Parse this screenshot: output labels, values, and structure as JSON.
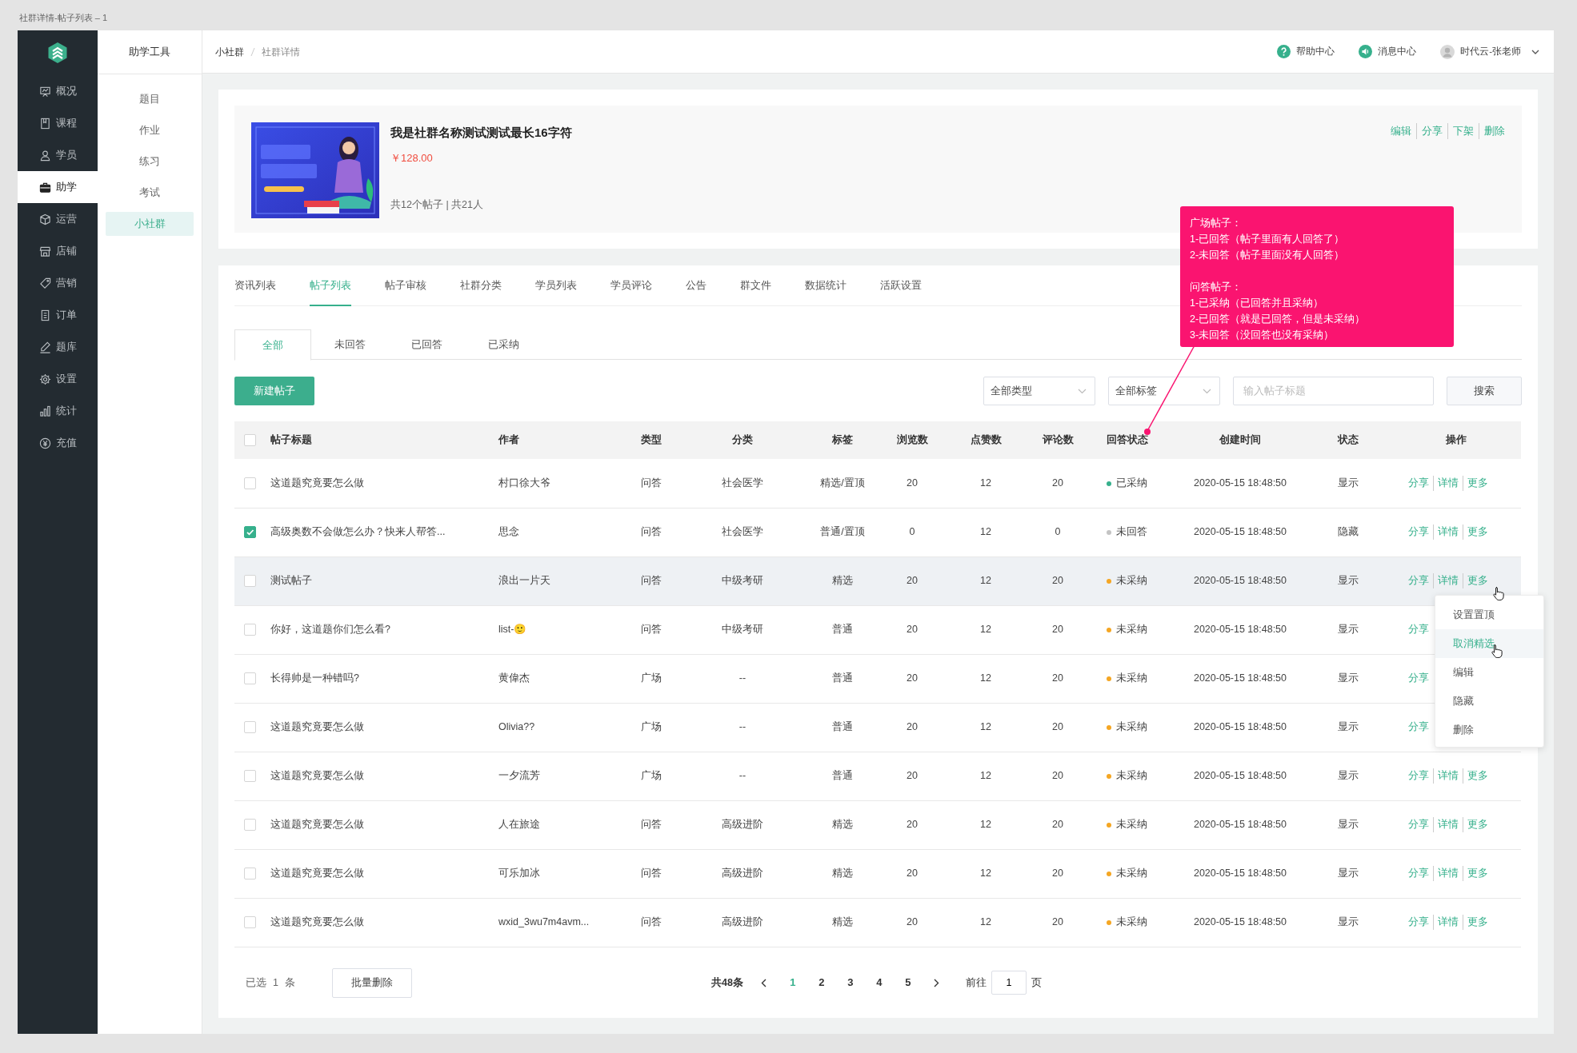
{
  "window": {
    "title": "社群详情-帖子列表 – 1"
  },
  "sidebar": {
    "items": [
      {
        "label": "概况",
        "selected": false
      },
      {
        "label": "课程",
        "selected": false
      },
      {
        "label": "学员",
        "selected": false
      },
      {
        "label": "助学",
        "selected": true
      },
      {
        "label": "运营",
        "selected": false
      },
      {
        "label": "店铺",
        "selected": false
      },
      {
        "label": "营销",
        "selected": false
      },
      {
        "label": "订单",
        "selected": false
      },
      {
        "label": "题库",
        "selected": false
      },
      {
        "label": "设置",
        "selected": false
      },
      {
        "label": "统计",
        "selected": false
      },
      {
        "label": "充值",
        "selected": false
      }
    ]
  },
  "subnav": {
    "title": "助学工具",
    "items": [
      {
        "label": "题目",
        "selected": false
      },
      {
        "label": "作业",
        "selected": false
      },
      {
        "label": "练习",
        "selected": false
      },
      {
        "label": "考试",
        "selected": false
      },
      {
        "label": "小社群",
        "selected": true
      }
    ]
  },
  "header": {
    "breadcrumb": [
      "小社群",
      "社群详情"
    ],
    "help": "帮助中心",
    "messages": "消息中心",
    "user": "时代云-张老师"
  },
  "community": {
    "image": {
      "kind": "picture"
    },
    "name": "我是社群名称测试测试最长16字符",
    "price": "￥128.00",
    "stats": "共12个帖子 | 共21人",
    "actions": [
      "编辑",
      "分享",
      "下架",
      "删除"
    ]
  },
  "tabs": [
    {
      "label": "资讯列表",
      "selected": false
    },
    {
      "label": "帖子列表",
      "selected": true
    },
    {
      "label": "帖子审核",
      "selected": false
    },
    {
      "label": "社群分类",
      "selected": false
    },
    {
      "label": "学员列表",
      "selected": false
    },
    {
      "label": "学员评论",
      "selected": false
    },
    {
      "label": "公告",
      "selected": false
    },
    {
      "label": "群文件",
      "selected": false
    },
    {
      "label": "数据统计",
      "selected": false
    },
    {
      "label": "活跃设置",
      "selected": false
    }
  ],
  "filter_tabs": [
    {
      "label": "全部",
      "selected": true
    },
    {
      "label": "未回答",
      "selected": false
    },
    {
      "label": "已回答",
      "selected": false
    },
    {
      "label": "已采纳",
      "selected": false
    }
  ],
  "toolbar": {
    "new_button": "新建帖子",
    "type_select": "全部类型",
    "tag_select": "全部标签",
    "search": {
      "placeholder": "输入帖子标题"
    },
    "search_button": "搜索"
  },
  "table": {
    "select_all": false,
    "columns": [
      "帖子标题",
      "作者",
      "类型",
      "分类",
      "标签",
      "浏览数",
      "点赞数",
      "评论数",
      "回答状态",
      "创建时间",
      "状态",
      "操作"
    ],
    "rows": [
      {
        "checked": false,
        "highlighted": false,
        "title": "这道题究竟要怎么做",
        "author": "村口徐大爷",
        "type": "问答",
        "category": "社会医学",
        "tag": "精选/置顶",
        "views": "20",
        "likes": "12",
        "comments": "20",
        "answer_status": "已采纳",
        "color": "#36b08c",
        "created": "2020-05-15 18:48:50",
        "state": "显示",
        "actions": [
          "分享",
          "详情",
          "更多"
        ]
      },
      {
        "checked": true,
        "highlighted": false,
        "title": "高级奥数不会做怎么办？快来人帮答...",
        "author": "思念",
        "type": "问答",
        "category": "社会医学",
        "tag": "普通/置顶",
        "views": "0",
        "likes": "12",
        "comments": "0",
        "answer_status": "未回答",
        "color": "#c4c4c4",
        "created": "2020-05-15 18:48:50",
        "state": "隐藏",
        "actions": [
          "分享",
          "详情",
          "更多"
        ]
      },
      {
        "checked": false,
        "highlighted": true,
        "title": "测试帖子",
        "author": "浪出一片天",
        "type": "问答",
        "category": "中级考研",
        "tag": "精选",
        "views": "20",
        "likes": "12",
        "comments": "20",
        "answer_status": "未采纳",
        "color": "#f5a623",
        "created": "2020-05-15 18:48:50",
        "state": "显示",
        "actions": [
          "分享",
          "详情",
          "更多"
        ]
      },
      {
        "checked": false,
        "highlighted": false,
        "title": "你好，这道题你们怎么看?",
        "author": "list-🙂",
        "type": "问答",
        "category": "中级考研",
        "tag": "普通",
        "views": "20",
        "likes": "12",
        "comments": "20",
        "answer_status": "未采纳",
        "color": "#f5a623",
        "created": "2020-05-15 18:48:50",
        "state": "显示",
        "actions": [
          "分享"
        ]
      },
      {
        "checked": false,
        "highlighted": false,
        "title": "长得帅是一种错吗?",
        "author": "黄偉杰",
        "type": "广场",
        "category": "--",
        "tag": "普通",
        "views": "20",
        "likes": "12",
        "comments": "20",
        "answer_status": "未采纳",
        "color": "#f5a623",
        "created": "2020-05-15 18:48:50",
        "state": "显示",
        "actions": [
          "分享"
        ]
      },
      {
        "checked": false,
        "highlighted": false,
        "title": "这道题究竟要怎么做",
        "author": "Olivia??",
        "type": "广场",
        "category": "--",
        "tag": "普通",
        "views": "20",
        "likes": "12",
        "comments": "20",
        "answer_status": "未采纳",
        "color": "#f5a623",
        "created": "2020-05-15 18:48:50",
        "state": "显示",
        "actions": [
          "分享"
        ]
      },
      {
        "checked": false,
        "highlighted": false,
        "title": "这道题究竟要怎么做",
        "author": "一夕流芳",
        "type": "广场",
        "category": "--",
        "tag": "普通",
        "views": "20",
        "likes": "12",
        "comments": "20",
        "answer_status": "未采纳",
        "color": "#f5a623",
        "created": "2020-05-15 18:48:50",
        "state": "显示",
        "actions": [
          "分享",
          "详情",
          "更多"
        ]
      },
      {
        "checked": false,
        "highlighted": false,
        "title": "这道题究竟要怎么做",
        "author": "人在旅途",
        "type": "问答",
        "category": "高级进阶",
        "tag": "精选",
        "views": "20",
        "likes": "12",
        "comments": "20",
        "answer_status": "未采纳",
        "color": "#f5a623",
        "created": "2020-05-15 18:48:50",
        "state": "显示",
        "actions": [
          "分享",
          "详情",
          "更多"
        ]
      },
      {
        "checked": false,
        "highlighted": false,
        "title": "这道题究竟要怎么做",
        "author": "可乐加冰",
        "type": "问答",
        "category": "高级进阶",
        "tag": "精选",
        "views": "20",
        "likes": "12",
        "comments": "20",
        "answer_status": "未采纳",
        "color": "#f5a623",
        "created": "2020-05-15 18:48:50",
        "state": "显示",
        "actions": [
          "分享",
          "详情",
          "更多"
        ]
      },
      {
        "checked": false,
        "highlighted": false,
        "title": "这道题究竟要怎么做",
        "author": "wxid_3wu7m4avm...",
        "type": "问答",
        "category": "高级进阶",
        "tag": "精选",
        "views": "20",
        "likes": "12",
        "comments": "20",
        "answer_status": "未采纳",
        "color": "#f5a623",
        "created": "2020-05-15 18:48:50",
        "state": "显示",
        "actions": [
          "分享",
          "详情",
          "更多"
        ]
      }
    ]
  },
  "menu": {
    "items": [
      {
        "label": "设置置顶",
        "hovered": false
      },
      {
        "label": "取消精选",
        "hovered": true
      },
      {
        "label": "编辑",
        "hovered": false
      },
      {
        "label": "隐藏",
        "hovered": false
      },
      {
        "label": "删除",
        "hovered": false
      }
    ]
  },
  "footer": {
    "selected_label": "已选",
    "selected_count": "1",
    "selected_unit": "条",
    "bulk_delete": "批量删除"
  },
  "pagination": {
    "total": "共48条",
    "pages": [
      {
        "label": "1",
        "selected": true
      },
      {
        "label": "2",
        "selected": false
      },
      {
        "label": "3",
        "selected": false
      },
      {
        "label": "4",
        "selected": false
      },
      {
        "label": "5",
        "selected": false
      }
    ],
    "goto_label": "前往",
    "goto_value": "1",
    "page_unit": "页"
  },
  "annotation": {
    "sections": [
      {
        "heading": "广场帖子：",
        "lines": [
          "1-已回答（帖子里面有人回答了）",
          "2-未回答（帖子里面没有人回答）"
        ]
      },
      {
        "heading": "问答帖子：",
        "lines": [
          "1-已采纳（已回答并且采纳）",
          "2-已回答（就是已回答，但是未采纳）",
          "3-未回答（没回答也没有采纳）"
        ]
      }
    ]
  }
}
